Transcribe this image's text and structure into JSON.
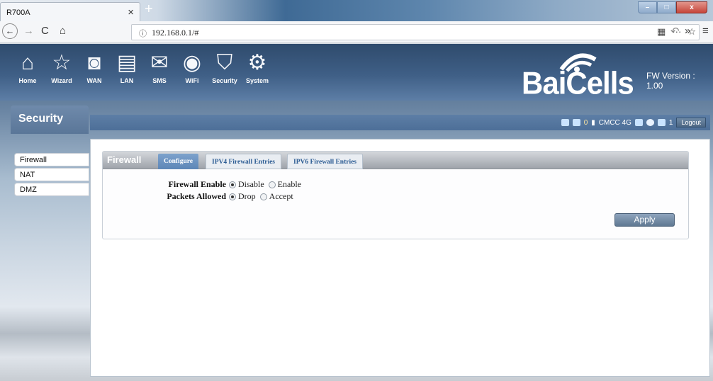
{
  "browser": {
    "tab_title": "R700A",
    "tab_close": "×",
    "new_tab": "+",
    "url_info": "ⓘ",
    "url": "192.168.0.1/#",
    "window": {
      "minimize": "–",
      "maximize": "□",
      "close": "x"
    }
  },
  "header": {
    "menu": [
      {
        "label": "Home",
        "icon": "home-icon"
      },
      {
        "label": "Wizard",
        "icon": "wizard-icon"
      },
      {
        "label": "WAN",
        "icon": "wan-icon"
      },
      {
        "label": "LAN",
        "icon": "lan-icon"
      },
      {
        "label": "SMS",
        "icon": "sms-icon"
      },
      {
        "label": "WiFi",
        "icon": "wifi-icon"
      },
      {
        "label": "Security",
        "icon": "security-icon"
      },
      {
        "label": "System",
        "icon": "system-icon"
      }
    ],
    "logo": "BaiCells",
    "fw_version": "FW Version : 1.00"
  },
  "section_title": "Security",
  "status": {
    "sms_count": "0",
    "operator": "CMCC 4G",
    "clients": "1",
    "logout": "Logout"
  },
  "sidebar": {
    "items": [
      {
        "label": "Firewall"
      },
      {
        "label": "NAT"
      },
      {
        "label": "DMZ"
      }
    ]
  },
  "firewall": {
    "title": "Firewall",
    "tabs": [
      "Configure",
      "IPV4 Firewall Entries",
      "IPV6 Firewall Entries"
    ],
    "enable_label": "Firewall Enable",
    "enable_options": [
      "Disable",
      "Enable"
    ],
    "enable_selected": "Disable",
    "packets_label": "Packets Allowed",
    "packets_options": [
      "Drop",
      "Accept"
    ],
    "packets_selected": "Drop",
    "apply": "Apply"
  },
  "colors": {
    "header_blue": "#3f5f86",
    "tab_active": "#5d86b7",
    "tab_link": "#2d5d94"
  }
}
